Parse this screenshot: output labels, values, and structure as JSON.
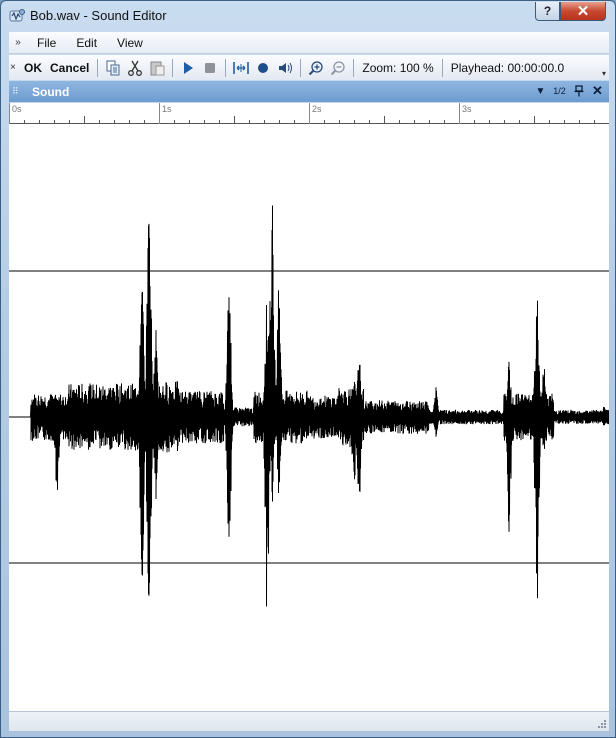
{
  "window": {
    "title": "Bob.wav - Sound Editor",
    "help_label": "?",
    "close_label": "✕"
  },
  "menu": {
    "items": [
      "File",
      "Edit",
      "View"
    ]
  },
  "toolbar": {
    "ok_label": "OK",
    "cancel_label": "Cancel",
    "zoom_text": "Zoom: 100 %",
    "playhead_text": "Playhead: 00:00:00.0",
    "icons": [
      "copy-icon",
      "cut-icon",
      "paste-icon",
      "play-icon",
      "stop-icon",
      "trim-icon",
      "record-icon",
      "volume-icon",
      "zoom-in-icon",
      "zoom-out-icon"
    ]
  },
  "panel": {
    "title": "Sound",
    "page_indicator": "1/2"
  },
  "ruler": {
    "labels": [
      "0s",
      "1s",
      "2s",
      "3s"
    ]
  },
  "colors": {
    "accent": "#6d9bd0",
    "waveform": "#000000",
    "window_frame": "#a9c3df"
  }
}
